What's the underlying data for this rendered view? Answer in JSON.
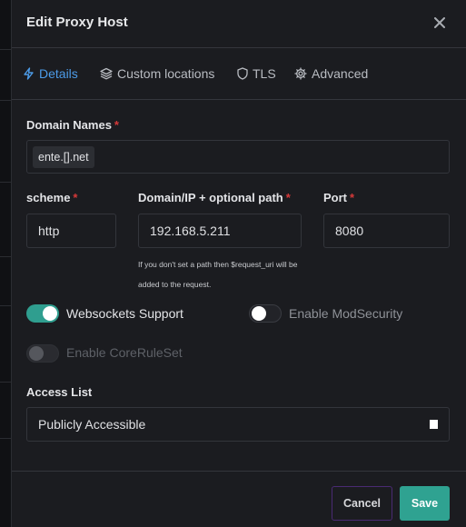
{
  "modal": {
    "title": "Edit Proxy Host"
  },
  "tabs": [
    {
      "label": "Details",
      "icon": "bolt-icon",
      "active": true
    },
    {
      "label": "Custom locations",
      "icon": "layers-icon",
      "active": false
    },
    {
      "label": "TLS",
      "icon": "shield-icon",
      "active": false
    },
    {
      "label": "Advanced",
      "icon": "gear-icon",
      "active": false
    }
  ],
  "domain_names": {
    "label": "Domain Names",
    "values": [
      "ente.[].net"
    ]
  },
  "scheme": {
    "label": "scheme",
    "value": "http"
  },
  "forward_host": {
    "label": "Domain/IP + optional path",
    "value": "192.168.5.211",
    "hint_line1": "If you don't set a path then $request_uri will be",
    "hint_line2": "added to the request."
  },
  "port": {
    "label": "Port",
    "value": "8080"
  },
  "toggles": {
    "websockets": {
      "label": "Websockets Support",
      "on": true
    },
    "modsecurity": {
      "label": "Enable ModSecurity",
      "on": false
    },
    "coreruleset": {
      "label": "Enable CoreRuleSet",
      "on": false,
      "disabled": true
    }
  },
  "access_list": {
    "label": "Access List",
    "value": "Publicly Accessible"
  },
  "footer": {
    "cancel_label": "Cancel",
    "save_label": "Save"
  },
  "colors": {
    "accent": "#4c9be8",
    "toggle_on": "#2f9e8f",
    "save_button": "#2fa291",
    "required": "#d63939"
  }
}
